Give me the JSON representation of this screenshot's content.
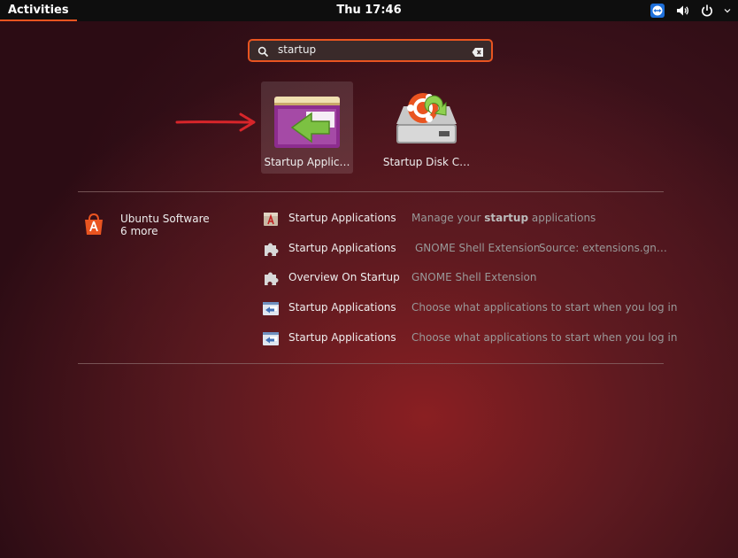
{
  "topbar": {
    "activities": "Activities",
    "clock": "Thu 17:46",
    "tray_icons": [
      "teamviewer-icon",
      "volume-icon",
      "power-icon"
    ]
  },
  "search": {
    "value": "startup",
    "icon": "search-icon",
    "clear_icon": "clear-icon"
  },
  "app_tiles": [
    {
      "label": "Startup Applic…",
      "icon": "startup-applications-icon",
      "selected": true
    },
    {
      "label": "Startup Disk C…",
      "icon": "startup-disk-creator-icon",
      "selected": false
    }
  ],
  "provider": {
    "name": "Ubuntu Software",
    "more": "6 more",
    "icon": "ubuntu-software-icon"
  },
  "results": [
    {
      "name": "Startup Applications",
      "desc_pre": "Manage your ",
      "desc_bold": "startup",
      "desc_post": " applications",
      "icon": "package-icon"
    },
    {
      "name": "Startup Applications",
      "desc": "GNOME Shell Extension",
      "source": "Source: extensions.gn…",
      "icon": "puzzle-icon"
    },
    {
      "name": "Overview On Startup",
      "desc": "GNOME Shell Extension",
      "icon": "puzzle-icon"
    },
    {
      "name": "Startup Applications",
      "desc": "Choose what applications to start when you log in",
      "icon": "startup-app-small-icon"
    },
    {
      "name": "Startup Applications",
      "desc": "Choose what applications to start when you log in",
      "icon": "startup-app-small-icon"
    }
  ],
  "colors": {
    "accent": "#e95420",
    "topbar": "#0e0e0e",
    "annotation_arrow": "#d8252a"
  }
}
